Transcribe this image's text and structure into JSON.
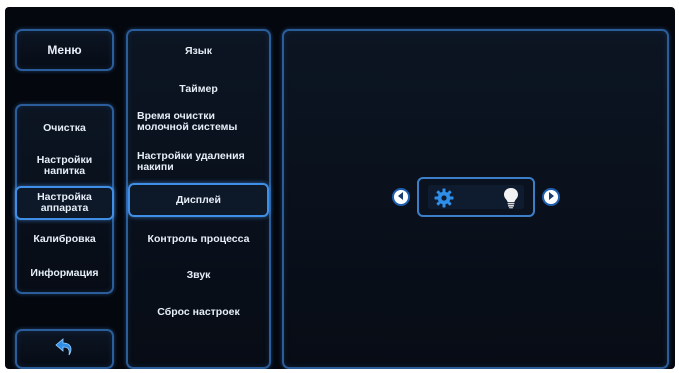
{
  "left_menu": {
    "menu_button_label": "Меню",
    "items": [
      {
        "label_lines": [
          "Очистка"
        ]
      },
      {
        "label_lines": [
          "Настройки",
          "напитка"
        ]
      },
      {
        "label_lines": [
          "Настройка",
          "аппарата"
        ],
        "selected": true
      },
      {
        "label_lines": [
          "Калибровка"
        ]
      },
      {
        "label_lines": [
          "Информация"
        ]
      }
    ],
    "back_icon": "return-arrow-icon"
  },
  "settings_menu": {
    "items": [
      {
        "label_lines": [
          "Язык"
        ]
      },
      {
        "label_lines": [
          "Таймер"
        ]
      },
      {
        "label_lines": [
          "Время очистки",
          "молочной системы"
        ]
      },
      {
        "label_lines": [
          "Настройки удаления",
          "накипи"
        ]
      },
      {
        "label_lines": [
          "Дисплей"
        ],
        "selected": true
      },
      {
        "label_lines": [
          "Контроль процесса"
        ]
      },
      {
        "label_lines": [
          "Звук"
        ]
      },
      {
        "label_lines": [
          "Сброс настроек"
        ]
      }
    ]
  },
  "display_setting": {
    "left_icon": "gear-icon",
    "right_icon": "light-bulb-icon",
    "prev_icon": "chevron-left-icon",
    "next_icon": "chevron-right-icon"
  },
  "colors": {
    "panel_border": "#2a5d9a",
    "selected_border": "#3f8fe6",
    "icon_blue": "#2f8fe8",
    "text": "#e6eef8",
    "background": "#04070d"
  }
}
